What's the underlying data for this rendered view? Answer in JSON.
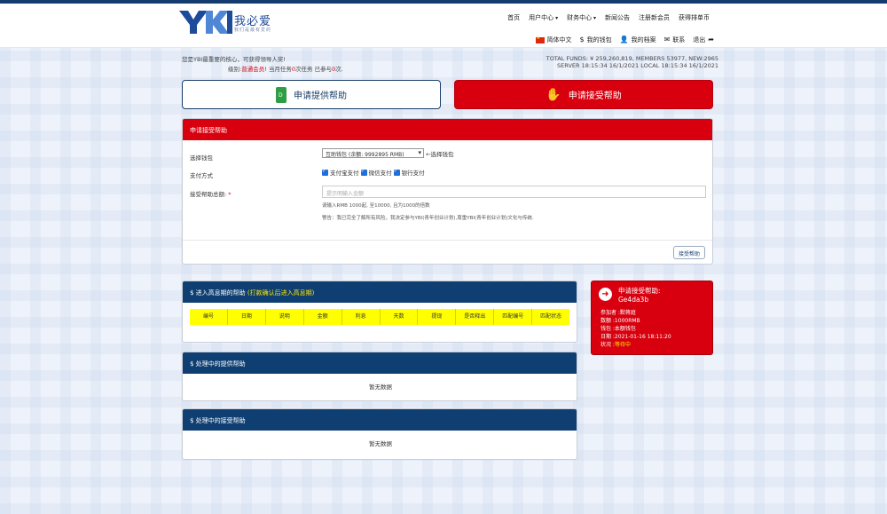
{
  "brand": {
    "name": "我必爱",
    "tagline": "我们是最有爱的",
    "mark": "YKI"
  },
  "nav": {
    "items": [
      "首页",
      "用户中心",
      "财务中心",
      "新闻公告",
      "注册新会员",
      "获得排单币"
    ]
  },
  "subnav": {
    "lang": "简体中文",
    "wallet": "我的钱包",
    "profile": "我的档案",
    "contact": "联系",
    "logout": "退出"
  },
  "welcome": {
    "line1": "您是YBI最重要的核心，可获得领导人奖!",
    "level_prefix": "级别:",
    "level": "普通会员",
    "mid": "! 当月任务",
    "task_count": "0",
    "mid2": "次任务 已参与",
    "joined": "0",
    "suffix": "次."
  },
  "funds": {
    "line1": "TOTAL FUNDS: ¥ 259,260,819, MEMBERS 53977, NEW:2965",
    "line2": "SERVER  18:15:34 16/1/2021  LOCAL  18:15:34 16/1/2021"
  },
  "buttons": {
    "provide": "申请提供帮助",
    "accept": "申请接受帮助"
  },
  "form": {
    "title": "申请接受帮助",
    "wallet_label": "选择钱包",
    "wallet_value": "互助钱包 (余额: 9992895 RMB)",
    "wallet_hint": "←选择钱包",
    "pay_label": "支付方式",
    "pay_options": [
      "支付宝支付",
      "微信支付",
      "银行支付"
    ],
    "amount_label": "接受帮助总额:",
    "required_mark": "*",
    "amount_placeholder": "提示明输入金额",
    "hint1": "请输入RMB 1000起, 至10000, 且为1000的倍数",
    "hint2": "警告：我已完全了解所有风险，我决定参与YBI(青年创业计划),尊重YBI(青年创业计划)文化与传统.",
    "submit": "接受帮助"
  },
  "interest_panel": {
    "title": "$ 进入高息期的帮助",
    "title_note": "(打款确认后进入高息期)",
    "columns": [
      "编号",
      "日期",
      "说明",
      "金额",
      "利息",
      "天数",
      "提现",
      "是否释出",
      "匹配编号",
      "匹配状态"
    ]
  },
  "provide_panel": {
    "title": "$ 处理中的提供帮助",
    "empty": "暂无数据"
  },
  "accept_panel": {
    "title": "$ 处理中的接受帮助",
    "empty": "暂无数据"
  },
  "side_card": {
    "title": "申请接受帮助:",
    "code": "Ge4da3b",
    "participant": "参加者 :默蒋庭",
    "amount": "数额 :1000RMB",
    "wallet": "钱包 :本额钱包",
    "date": "日期 :2021-01-16 18:11:20",
    "status_label": "状况 :",
    "status": "等待中"
  },
  "colors": {
    "brand_red": "#d8000f",
    "brand_blue": "#0f3f72",
    "highlight": "#ffff00"
  }
}
